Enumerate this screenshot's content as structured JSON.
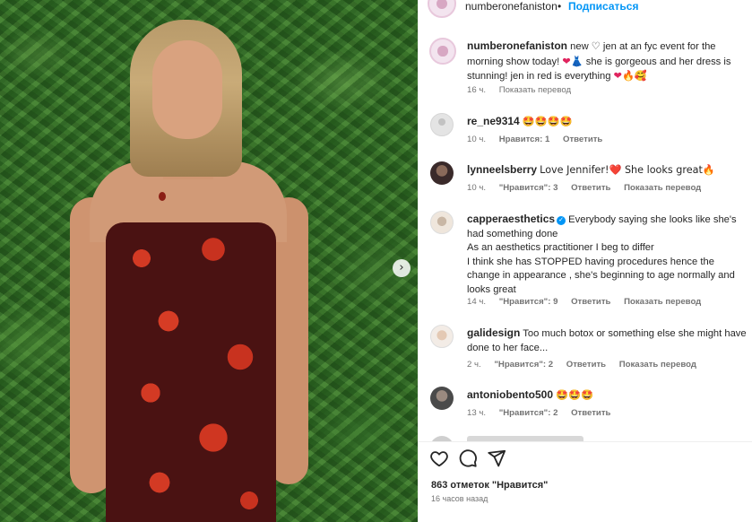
{
  "post": {
    "username": "numberonefaniston",
    "dot": "•",
    "follow_label": "Подписаться"
  },
  "caption": {
    "username": "numberonefaniston",
    "text_1": "new ",
    "text_2": " jen at an fyc event for the morning show today! ",
    "text_3": " she is gorgeous and her dress is stunning! jen in red is everything ",
    "time": "16 ч.",
    "translate": "Показать перевод"
  },
  "comments": [
    {
      "username": "re_ne9314",
      "text": "🤩🤩🤩🤩",
      "time": "10 ч.",
      "likes": "Нравится: 1",
      "reply": "Ответить",
      "translate": ""
    },
    {
      "username": "lynneelsberry",
      "text": "Love Jennifer!❤️ She looks great🔥",
      "time": "10 ч.",
      "likes": "\"Нравится\": 3",
      "reply": "Ответить",
      "translate": "Показать перевод"
    },
    {
      "username": "capperaesthetics",
      "verified": true,
      "text": "Everybody saying she looks like she's had something done",
      "text_2": "As an aesthetics practitioner I beg to differ",
      "text_3": "I think she has STOPPED having procedures hence the change in appearance , she's beginning to age normally and looks great",
      "time": "14 ч.",
      "likes": "\"Нравится\": 9",
      "reply": "Ответить",
      "translate": "Показать перевод"
    },
    {
      "username": "galidesign",
      "text": "Too much botox or something else she might have done to her face...",
      "time": "2 ч.",
      "likes": "\"Нравится\": 2",
      "reply": "Ответить",
      "translate": "Показать перевод"
    },
    {
      "username": "antoniobento500",
      "text": "🤩🤩🤩",
      "time": "13 ч.",
      "likes": "\"Нравится\": 2",
      "reply": "Ответить",
      "translate": ""
    }
  ],
  "footer": {
    "likes": "863 отметок \"Нравится\"",
    "time": "16 часов назад"
  },
  "icons": {
    "heart": "heart-icon",
    "comment": "comment-icon",
    "share": "share-icon",
    "carousel_next": "chevron-right-icon"
  },
  "colors": {
    "accent": "#0095f6",
    "text": "#262626",
    "muted": "#737373"
  }
}
